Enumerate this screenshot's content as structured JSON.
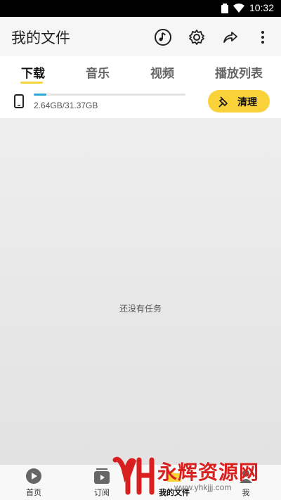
{
  "status_bar": {
    "time": "10:32"
  },
  "app_bar": {
    "title": "我的文件"
  },
  "tabs": [
    {
      "label": "下载",
      "active": true
    },
    {
      "label": "音乐",
      "active": false
    },
    {
      "label": "视频",
      "active": false
    },
    {
      "label": "播放列表",
      "active": false
    }
  ],
  "storage": {
    "usage_text": "2.64GB/31.37GB",
    "used_fraction": 0.084
  },
  "clean_button": {
    "label": "清理"
  },
  "empty_state": {
    "message": "还没有任务"
  },
  "bottom_nav": [
    {
      "label": "首页",
      "icon": "play-circle-icon",
      "active": false
    },
    {
      "label": "订阅",
      "icon": "subscription-icon",
      "active": false
    },
    {
      "label": "我的文件",
      "icon": "folder-icon",
      "active": true
    },
    {
      "label": "我",
      "icon": "user-icon",
      "active": false
    }
  ],
  "watermark": {
    "text": "永辉资源网",
    "url": "www.yhkjjj.com"
  },
  "colors": {
    "accent_yellow": "#f9d23a",
    "progress_blue": "#2aa6d9",
    "watermark_red": "#d8211f"
  }
}
